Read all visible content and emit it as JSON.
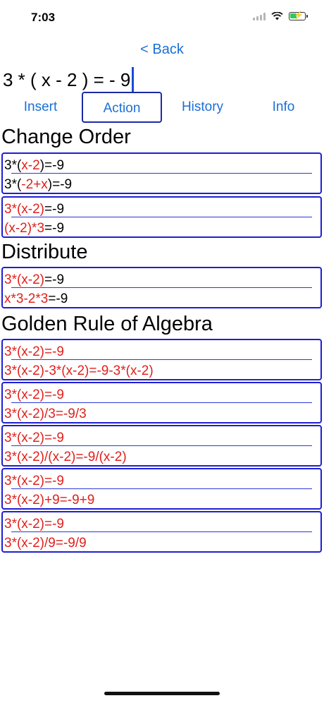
{
  "status": {
    "time": "7:03"
  },
  "nav": {
    "back_label": "< Back"
  },
  "expression": "3 * ( x - 2 ) = - 9",
  "tabs": [
    {
      "label": "Insert",
      "active": false
    },
    {
      "label": "Action",
      "active": true
    },
    {
      "label": "History",
      "active": false
    },
    {
      "label": "Info",
      "active": false
    }
  ],
  "sections": {
    "change_order": "Change Order",
    "distribute": "Distribute",
    "golden_rule": "Golden Rule of Algebra"
  },
  "actions": {
    "change_order_1": {
      "top": [
        {
          "t": "3*(",
          "c": "k"
        },
        {
          "t": "x-2",
          "c": "r"
        },
        {
          "t": ")=-9",
          "c": "k"
        }
      ],
      "bottom": [
        {
          "t": "3*(",
          "c": "k"
        },
        {
          "t": "-2+x",
          "c": "r"
        },
        {
          "t": ")=-9",
          "c": "k"
        }
      ]
    },
    "change_order_2": {
      "top": [
        {
          "t": "3*(x-2)",
          "c": "r"
        },
        {
          "t": "=-9",
          "c": "k"
        }
      ],
      "bottom": [
        {
          "t": "(x-2)*3",
          "c": "r"
        },
        {
          "t": "=-9",
          "c": "k"
        }
      ]
    },
    "distribute_1": {
      "top": [
        {
          "t": "3*(x-2)",
          "c": "r"
        },
        {
          "t": "=-9",
          "c": "k"
        }
      ],
      "bottom": [
        {
          "t": "x*3-2*3",
          "c": "r"
        },
        {
          "t": "=-9",
          "c": "k"
        }
      ]
    },
    "golden_1": {
      "top": [
        {
          "t": "3*(x-2)=-9",
          "c": "r"
        }
      ],
      "bottom": [
        {
          "t": "3*(x-2)-3*(x-2)=-9-3*(x-2)",
          "c": "r"
        }
      ]
    },
    "golden_2": {
      "top": [
        {
          "t": "3*(x-2)=-9",
          "c": "r"
        }
      ],
      "bottom": [
        {
          "t": "3*(x-2)/3=-9/3",
          "c": "r"
        }
      ]
    },
    "golden_3": {
      "top": [
        {
          "t": "3*(x-2)=-9",
          "c": "r"
        }
      ],
      "bottom": [
        {
          "t": "3*(x-2)/(x-2)=-9/(x-2)",
          "c": "r"
        }
      ]
    },
    "golden_4": {
      "top": [
        {
          "t": "3*(x-2)=-9",
          "c": "r"
        }
      ],
      "bottom": [
        {
          "t": "3*(x-2)+9=-9+9",
          "c": "r"
        }
      ]
    },
    "golden_5": {
      "top": [
        {
          "t": "3*(x-2)=-9",
          "c": "r"
        }
      ],
      "bottom": [
        {
          "t": "3*(x-2)/9=-9/9",
          "c": "r"
        }
      ]
    }
  },
  "colors": {
    "accent": "#1a6fd6",
    "highlight": "#e0201c",
    "card_border": "#1f1fd0"
  },
  "icons": [
    "signal-icon",
    "wifi-icon",
    "battery-icon"
  ]
}
